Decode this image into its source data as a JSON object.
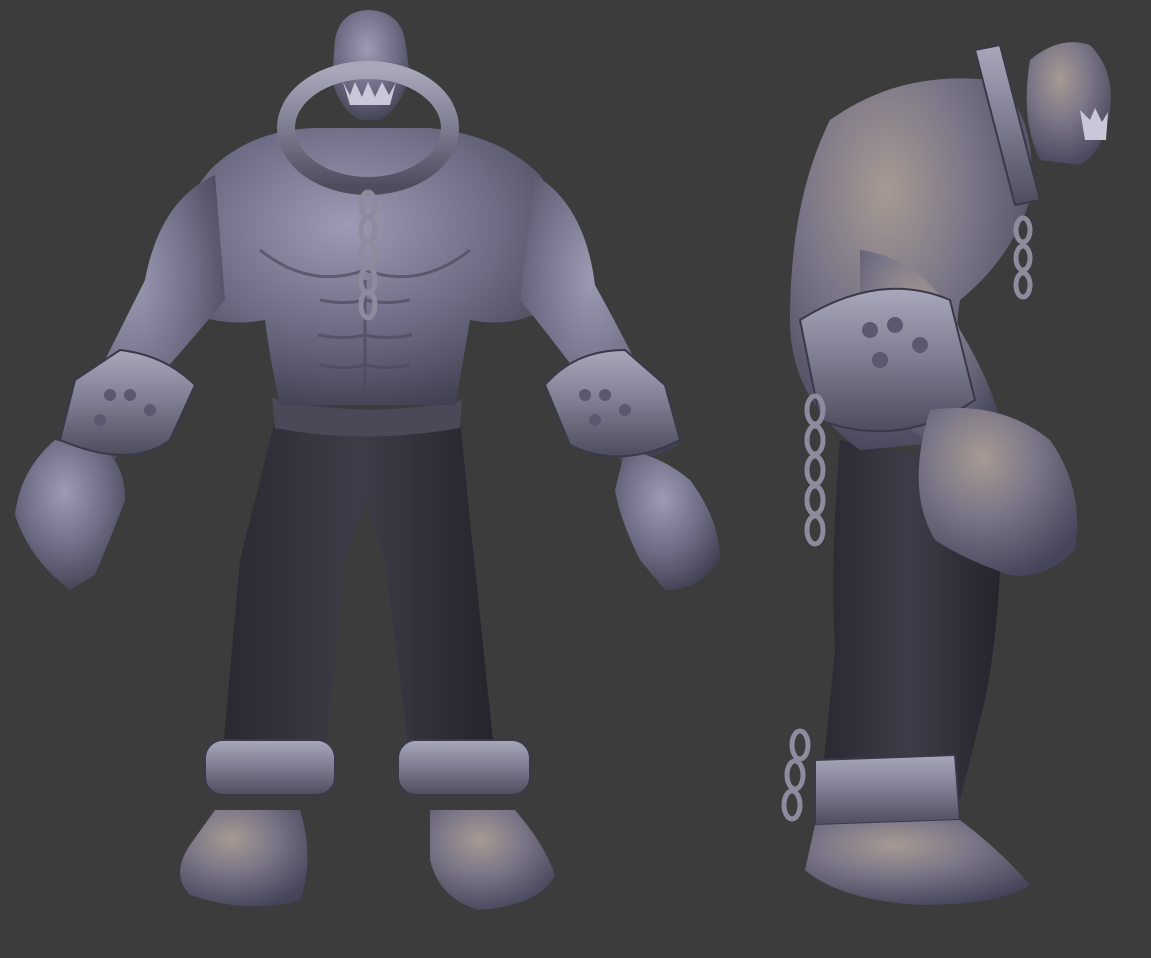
{
  "scene": {
    "subject": "sculpted-creature-render",
    "views": [
      "front",
      "side"
    ],
    "colors": {
      "background": "#3c3c3c",
      "skin_light": "#8f8ea6",
      "skin_mid": "#6a6980",
      "skin_dark": "#3f3e4d",
      "pants": "#2f2e38",
      "metal": "#8b8a9c"
    }
  }
}
